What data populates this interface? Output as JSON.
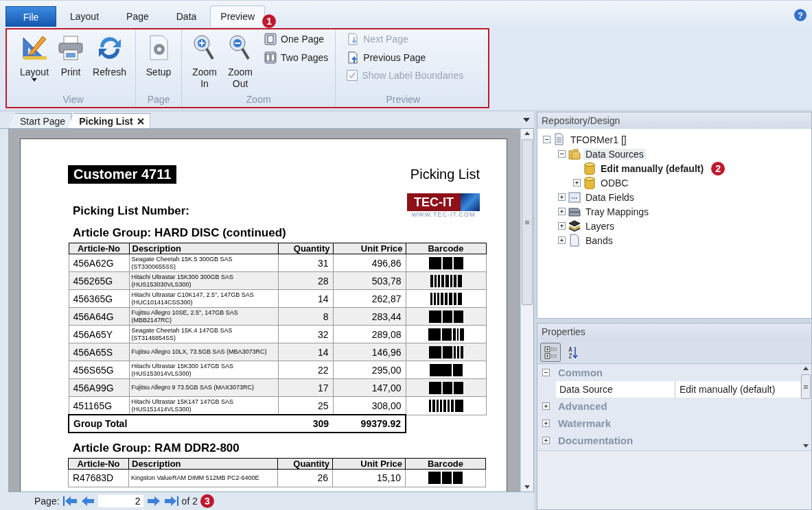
{
  "ribbon": {
    "tabs": [
      {
        "label": "File",
        "kind": "menu",
        "selected": false
      },
      {
        "label": "Layout",
        "kind": "tab",
        "selected": false
      },
      {
        "label": "Page",
        "kind": "tab",
        "selected": false
      },
      {
        "label": "Data",
        "kind": "tab",
        "selected": false
      },
      {
        "label": "Preview",
        "kind": "tab",
        "selected": true
      }
    ],
    "badge": "1",
    "help": "?",
    "groups": [
      {
        "label": "View",
        "items": [
          {
            "kind": "large",
            "label": "Layout",
            "dropdown": true,
            "disabled": false
          },
          {
            "kind": "large",
            "label": "Print",
            "disabled": false
          },
          {
            "kind": "large",
            "label": "Refresh",
            "disabled": false
          }
        ]
      },
      {
        "label": "Page",
        "items": [
          {
            "kind": "large",
            "label": "Setup",
            "disabled": false
          }
        ]
      },
      {
        "label": "Zoom",
        "items": [
          {
            "kind": "large",
            "label": "Zoom In",
            "disabled": false
          },
          {
            "kind": "large",
            "label": "Zoom Out",
            "disabled": false
          },
          {
            "kind": "small",
            "label": "One Page",
            "disabled": false
          },
          {
            "kind": "small",
            "label": "Two Pages",
            "disabled": false
          }
        ]
      },
      {
        "label": "Preview",
        "items": [
          {
            "kind": "small",
            "label": "Next Page",
            "disabled": true
          },
          {
            "kind": "small",
            "label": "Previous Page",
            "disabled": false
          },
          {
            "kind": "checkbox",
            "label": "Show Label Boundaries",
            "checked": true,
            "disabled": true
          }
        ]
      }
    ]
  },
  "document_tabs": [
    {
      "label": "Start Page",
      "selected": false,
      "closable": false
    },
    {
      "label": "Picking List",
      "selected": true,
      "closable": true
    }
  ],
  "document": {
    "customer": "Customer 4711",
    "title": "Picking List",
    "number_label": "Picking List Number:",
    "logo": {
      "name": "TEC-IT",
      "url": "WWW.TEC-IT.COM"
    },
    "groups": [
      {
        "heading": "Article Group: HARD DISC (continued)",
        "columns": [
          "Article-No",
          "Description",
          "Quantity",
          "Unit Price",
          "Barcode"
        ],
        "rows": [
          {
            "article": "456A62G",
            "description": "Seagate Cheetah 15K.5 300GB SAS (ST3300655SS)",
            "quantity": "31",
            "price": "496,86"
          },
          {
            "article": "456265G",
            "description": "Hitachi Ultrastar 15K300 300GB SAS (HUS153030VLS300)",
            "quantity": "28",
            "price": "503,78"
          },
          {
            "article": "456365G",
            "description": "Hitachi Ultrastar C10K147, 2.5\", 147GB SAS (HUC101414CSS300)",
            "quantity": "14",
            "price": "262,87"
          },
          {
            "article": "456A64G",
            "description": "Fujitsu Allegro 10SE, 2.5\", 147GB SAS (MBB2147RC)",
            "quantity": "8",
            "price": "283,44"
          },
          {
            "article": "456A65Y",
            "description": "Seagate Cheetah 15K.4 147GB SAS (ST3146854SS)",
            "quantity": "32",
            "price": "289,08"
          },
          {
            "article": "456A65S",
            "description": "Fujitsu Allegro 10LX, 73.5GB SAS (MBA3073RC)",
            "quantity": "14",
            "price": "146,96"
          },
          {
            "article": "456S65G",
            "description": "Hitachi Ultrastar 15K300 147GB SAS (HUS153014VLS300)",
            "quantity": "22",
            "price": "295,00"
          },
          {
            "article": "456A99G",
            "description": "Fujitsu Allegro 9 73.5GB SAS (MAX3073RC)",
            "quantity": "17",
            "price": "147,00"
          },
          {
            "article": "451165G",
            "description": "Hitachi Ultrastar 15K147 147GB SAS (HUS151414VLS300)",
            "quantity": "25",
            "price": "308,00"
          }
        ],
        "total": {
          "label": "Group Total",
          "quantity": "309",
          "price": "99379.92"
        }
      },
      {
        "heading": "Article Group: RAM DDR2-800",
        "columns": [
          "Article-No",
          "Description",
          "Quantity",
          "Unit Price",
          "Barcode"
        ],
        "rows": [
          {
            "article": "R47683D",
            "description": "Kingston ValueRAM DIMM 512MB PC2-6400E",
            "quantity": "26",
            "price": "15,10"
          }
        ]
      }
    ]
  },
  "pager": {
    "label": "Page:",
    "value": "2",
    "of": "of 2",
    "badge": "3"
  },
  "repository": {
    "title": "Repository/Design",
    "badge": "2",
    "tree": [
      {
        "label": "TFORMer1 []",
        "kind": "form",
        "expanded": true,
        "selected": false,
        "default": false,
        "children": [
          {
            "label": "Data Sources",
            "kind": "folder",
            "expanded": true,
            "selected": true,
            "default": false,
            "children": [
              {
                "label": "Edit manually (default)",
                "kind": "source",
                "selected": false,
                "default": true
              },
              {
                "label": "ODBC",
                "kind": "source",
                "expanded": false,
                "selected": false,
                "default": false
              }
            ]
          },
          {
            "label": "Data Fields",
            "kind": "fields",
            "expanded": false,
            "selected": false,
            "default": false
          },
          {
            "label": "Tray Mappings",
            "kind": "tray",
            "expanded": false,
            "selected": false,
            "default": false
          },
          {
            "label": "Layers",
            "kind": "layers",
            "expanded": false,
            "selected": false,
            "default": false
          },
          {
            "label": "Bands",
            "kind": "bands",
            "expanded": false,
            "selected": false,
            "default": false
          }
        ]
      }
    ]
  },
  "properties": {
    "title": "Properties",
    "view_buttons": [
      {
        "kind": "categorized",
        "selected": true
      },
      {
        "kind": "alphabetical",
        "selected": false
      }
    ],
    "categories": [
      {
        "label": "Common",
        "expanded": true,
        "properties": [
          {
            "name": "Data Source",
            "value": "Edit manually (default)"
          }
        ]
      },
      {
        "label": "Advanced",
        "expanded": false
      },
      {
        "label": "Watermark",
        "expanded": false
      },
      {
        "label": "Documentation",
        "expanded": false
      }
    ]
  }
}
